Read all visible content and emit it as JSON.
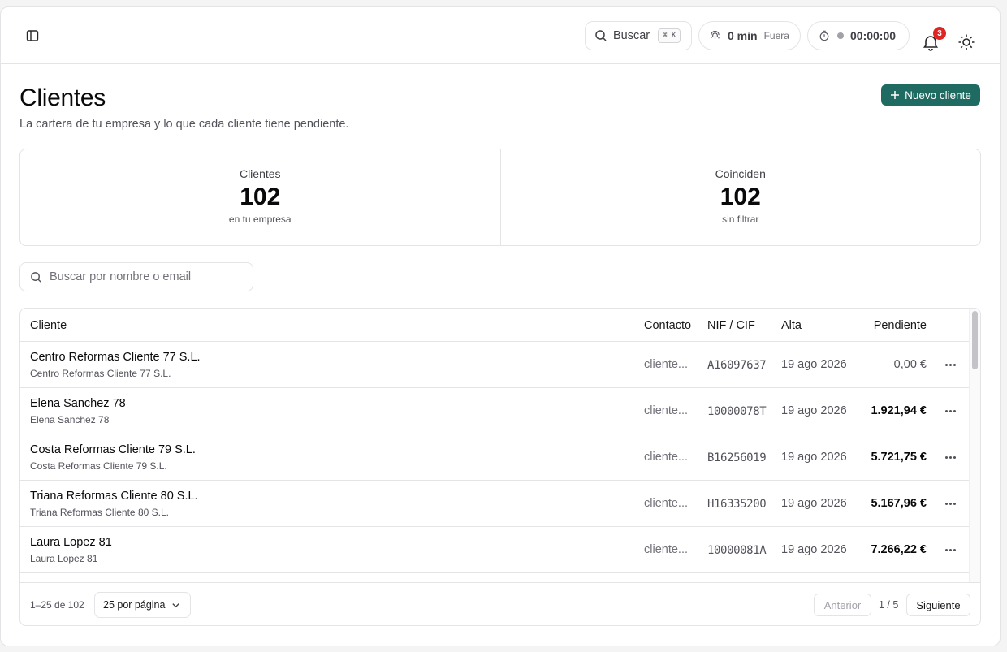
{
  "header": {
    "search_label": "Buscar",
    "search_shortcut": "⌘ K",
    "clock_value": "0 min",
    "clock_state": "Fuera",
    "timer_value": "00:00:00",
    "notifications_count": "3"
  },
  "page": {
    "title": "Clientes",
    "subtitle": "La cartera de tu empresa y lo que cada cliente tiene pendiente.",
    "new_button": "Nuevo cliente"
  },
  "stats": [
    {
      "label": "Clientes",
      "value": "102",
      "note": "en tu empresa"
    },
    {
      "label": "Coinciden",
      "value": "102",
      "note": "sin filtrar"
    }
  ],
  "search": {
    "placeholder": "Buscar por nombre o email"
  },
  "table": {
    "columns": {
      "cliente": "Cliente",
      "contacto": "Contacto",
      "nif": "NIF / CIF",
      "alta": "Alta",
      "pendiente": "Pendiente"
    },
    "rows": [
      {
        "name": "Centro Reformas Cliente 77 S.L.",
        "sub": "Centro Reformas Cliente 77 S.L.",
        "contact": "cliente...",
        "nif": "A16097637",
        "alta": "19 ago 2026",
        "pendiente": "0,00 €"
      },
      {
        "name": "Elena Sanchez 78",
        "sub": "Elena Sanchez 78",
        "contact": "cliente...",
        "nif": "10000078T",
        "alta": "19 ago 2026",
        "pendiente": "1.921,94 €"
      },
      {
        "name": "Costa Reformas Cliente 79 S.L.",
        "sub": "Costa Reformas Cliente 79 S.L.",
        "contact": "cliente...",
        "nif": "B16256019",
        "alta": "19 ago 2026",
        "pendiente": "5.721,75 €"
      },
      {
        "name": "Triana Reformas Cliente 80 S.L.",
        "sub": "Triana Reformas Cliente 80 S.L.",
        "contact": "cliente...",
        "nif": "H16335200",
        "alta": "19 ago 2026",
        "pendiente": "5.167,96 €"
      },
      {
        "name": "Laura Lopez 81",
        "sub": "Laura Lopez 81",
        "contact": "cliente...",
        "nif": "10000081A",
        "alta": "19 ago 2026",
        "pendiente": "7.266,22 €"
      }
    ]
  },
  "pagination": {
    "range": "1–25 de 102",
    "per_page": "25 por página",
    "prev": "Anterior",
    "page_info": "1 / 5",
    "next": "Siguiente"
  },
  "colors": {
    "accent": "#1f6b62",
    "badge": "#dc2626"
  }
}
